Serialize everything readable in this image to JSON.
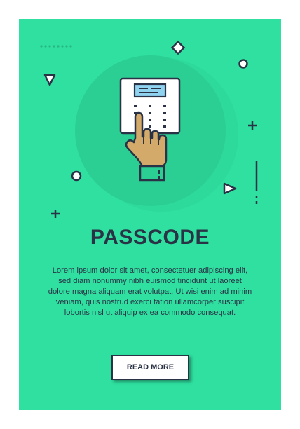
{
  "title": "PASSCODE",
  "description": "Lorem ipsum dolor sit amet, consectetuer adipiscing elit, sed diam nonummy nibh euismod tincidunt ut laoreet dolore magna aliquam erat volutpat. Ut wisi enim ad minim veniam, quis nostrud exerci tation ullamcorper suscipit lobortis nisl ut aliquip ex ea commodo consequat.",
  "button_label": "READ MORE",
  "icons": [
    "keypad-icon",
    "pointing-hand-icon"
  ],
  "colors": {
    "background": "#2fe0a0",
    "circle": "#2bcf94",
    "ink": "#2a3245",
    "screen": "#8fd3f0",
    "hand": "#d3aa6a"
  }
}
